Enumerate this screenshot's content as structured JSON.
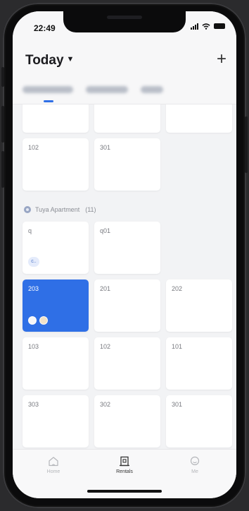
{
  "status_bar": {
    "time": "22:49"
  },
  "header": {
    "title": "Today",
    "add_icon": "plus-icon"
  },
  "top_rows": [
    {
      "tiles": [
        "",
        "",
        ""
      ]
    },
    {
      "tiles": [
        "102",
        "301"
      ]
    }
  ],
  "group": {
    "name": "Tuya Apartment",
    "count": "(11)"
  },
  "rooms": [
    {
      "label": "q",
      "chip": "c.."
    },
    {
      "label": "q01"
    },
    {
      "label": "203",
      "active": true
    },
    {
      "label": "201"
    },
    {
      "label": "202"
    },
    {
      "label": "103"
    },
    {
      "label": "102"
    },
    {
      "label": "101"
    },
    {
      "label": "303"
    },
    {
      "label": "302"
    },
    {
      "label": "301"
    }
  ],
  "tabbar": {
    "items": [
      {
        "label": "Home",
        "icon": "home-icon"
      },
      {
        "label": "Rentals",
        "icon": "rentals-icon",
        "active": true
      },
      {
        "label": "Me",
        "icon": "me-icon"
      }
    ]
  },
  "colors": {
    "accent": "#2f6fe6",
    "background": "#f2f3f5"
  }
}
